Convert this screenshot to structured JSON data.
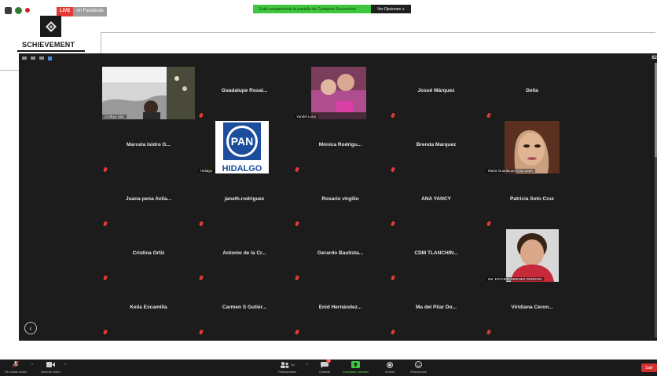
{
  "live": {
    "tag": "LIVE",
    "platform": "on Facebook"
  },
  "share_banner": {
    "message": "Está compartiendo la pantalla de Computer Screenshot",
    "options": "Ver Opciones ∨"
  },
  "brand": "SCHIEVEMENT",
  "colors": {
    "accent_green": "#3ec73e",
    "live_red": "#e53935",
    "end_red": "#d32f2f",
    "window_bg": "#1c1c1c"
  },
  "right_badge": "82",
  "tiles": [
    {
      "name": "",
      "video": "Cinthya sida",
      "kind": "webcam"
    },
    {
      "name": "Guadalupe  Rosal...",
      "video": "",
      "kind": "name"
    },
    {
      "name": "",
      "video": "Yandel Luna",
      "kind": "photo"
    },
    {
      "name": "Josué Márquez",
      "video": "",
      "kind": "name"
    },
    {
      "name": "Delia",
      "video": "",
      "kind": "name"
    },
    {
      "name": "Marcela Isidro G...",
      "video": "",
      "kind": "name"
    },
    {
      "name": "",
      "video": "Hidalgo",
      "kind": "pan"
    },
    {
      "name": "Mónica  Rodrigu...",
      "video": "",
      "kind": "name"
    },
    {
      "name": "Brenda Marquez",
      "video": "",
      "kind": "name"
    },
    {
      "name": "",
      "video": "María Guadalupe Cruz Leon",
      "kind": "face"
    },
    {
      "name": "Juana pena Avila...",
      "video": "",
      "kind": "name"
    },
    {
      "name": "janeth.rodriguez",
      "video": "",
      "kind": "name"
    },
    {
      "name": "Rosario virgilio",
      "video": "",
      "kind": "name"
    },
    {
      "name": "ANA YANCY",
      "video": "",
      "kind": "name"
    },
    {
      "name": "Patricia Soto Cruz",
      "video": "",
      "kind": "name"
    },
    {
      "name": "Cristina Ortiz",
      "video": "",
      "kind": "name"
    },
    {
      "name": "Antonio de la Cr...",
      "video": "",
      "kind": "name"
    },
    {
      "name": "Gerardo Bautista...",
      "video": "",
      "kind": "name"
    },
    {
      "name": "CDM  TLANCHIN...",
      "video": "",
      "kind": "name"
    },
    {
      "name": "",
      "video": "Ma. ESTHER JIMENEZ RENDON",
      "kind": "portrait"
    },
    {
      "name": "Keila Escamilla",
      "video": "",
      "kind": "name"
    },
    {
      "name": "Carmen S Gutiér...",
      "video": "",
      "kind": "name"
    },
    {
      "name": "Enid  Hernández...",
      "video": "",
      "kind": "name"
    },
    {
      "name": "Ma del Pilar Do...",
      "video": "",
      "kind": "name"
    },
    {
      "name": "Viridiana  Ceron...",
      "video": "",
      "kind": "name"
    }
  ],
  "pan_logo": {
    "top": "PAN",
    "bottom": "HIDALGO"
  },
  "toolbar": {
    "unmute": "Re-Iniciar Audio",
    "video": "Detener video",
    "participants": "Participantes",
    "participants_count": "54",
    "chat": "Chatear",
    "chat_badge": "10",
    "share": "Compartir pantalla",
    "record": "Grabar",
    "reactions": "Reacciones",
    "end": "Salir"
  }
}
